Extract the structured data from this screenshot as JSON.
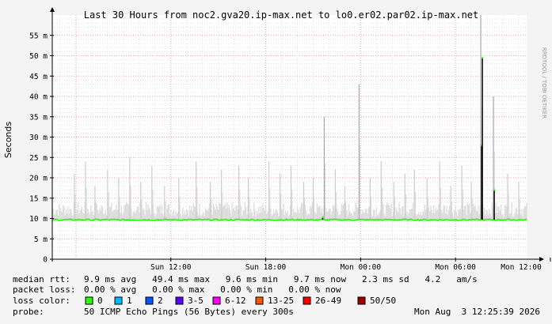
{
  "chart_data": {
    "type": "area",
    "title": "Last 30 Hours from noc2.gva20.ip-max.net to lo0.er02.par02.ip-max.net",
    "ylabel": "Seconds",
    "watermark": "RRDTOOL / TOBI OETIKER",
    "y_unit_suffix": " m",
    "ylim": [
      0,
      60
    ],
    "yticks": [
      0,
      5,
      10,
      15,
      20,
      25,
      30,
      35,
      40,
      45,
      50,
      55
    ],
    "x_range_hours": [
      4.5,
      34.5
    ],
    "x_ticks": [
      {
        "hour": 12,
        "label": "Sun 12:00"
      },
      {
        "hour": 18,
        "label": "Sun 18:00"
      },
      {
        "hour": 24,
        "label": "Mon 00:00"
      },
      {
        "hour": 30,
        "label": "Mon 06:00"
      },
      {
        "hour": 36,
        "label": "Mon 12:00"
      }
    ],
    "median_rtt_ms": 9.7,
    "spikes": [
      {
        "hour": 5.9,
        "value": 21
      },
      {
        "hour": 6.6,
        "value": 24
      },
      {
        "hour": 7.2,
        "value": 18
      },
      {
        "hour": 8.0,
        "value": 22
      },
      {
        "hour": 8.7,
        "value": 20
      },
      {
        "hour": 9.4,
        "value": 25
      },
      {
        "hour": 10.1,
        "value": 19
      },
      {
        "hour": 10.8,
        "value": 23
      },
      {
        "hour": 11.6,
        "value": 18
      },
      {
        "hour": 12.5,
        "value": 20
      },
      {
        "hour": 13.6,
        "value": 24
      },
      {
        "hour": 14.5,
        "value": 19
      },
      {
        "hour": 15.2,
        "value": 22
      },
      {
        "hour": 16.3,
        "value": 23
      },
      {
        "hour": 16.9,
        "value": 20
      },
      {
        "hour": 18.2,
        "value": 24
      },
      {
        "hour": 18.9,
        "value": 21
      },
      {
        "hour": 19.6,
        "value": 23
      },
      {
        "hour": 20.4,
        "value": 19
      },
      {
        "hour": 21.0,
        "value": 20
      },
      {
        "hour": 21.7,
        "value": 35
      },
      {
        "hour": 22.4,
        "value": 22
      },
      {
        "hour": 23.0,
        "value": 18
      },
      {
        "hour": 23.9,
        "value": 43
      },
      {
        "hour": 24.6,
        "value": 20
      },
      {
        "hour": 25.3,
        "value": 24
      },
      {
        "hour": 26.1,
        "value": 19
      },
      {
        "hour": 26.8,
        "value": 21
      },
      {
        "hour": 27.4,
        "value": 22
      },
      {
        "hour": 28.2,
        "value": 20
      },
      {
        "hour": 29.0,
        "value": 24
      },
      {
        "hour": 29.7,
        "value": 18
      },
      {
        "hour": 30.4,
        "value": 23
      },
      {
        "hour": 31.0,
        "value": 19
      },
      {
        "hour": 31.6,
        "value": 60
      },
      {
        "hour": 32.4,
        "value": 40
      },
      {
        "hour": 33.3,
        "value": 21
      },
      {
        "hour": 34.0,
        "value": 19
      }
    ],
    "median_spikes": [
      {
        "hour": 21.6,
        "value": 10.3
      },
      {
        "hour": 31.65,
        "value": 28
      },
      {
        "hour": 31.7,
        "value": 49.5
      },
      {
        "hour": 32.45,
        "value": 17
      }
    ]
  },
  "footer": {
    "rows": [
      {
        "label": "median rtt:",
        "text": "9.9 ms avg   49.4 ms max   9.6 ms min   9.7 ms now   2.3 ms sd   4.2   am/s"
      },
      {
        "label": "packet loss:",
        "text": "0.00 % avg   0.00 % max   0.00 % min   0.00 % now"
      },
      {
        "label": "loss color:",
        "text": ""
      },
      {
        "label": "probe:",
        "text": "50 ICMP Echo Pings (56 Bytes) every 300s"
      }
    ],
    "loss_colors": [
      {
        "label": "0",
        "color": "#26ff00"
      },
      {
        "label": "1",
        "color": "#00b8ff"
      },
      {
        "label": "2",
        "color": "#0059ff"
      },
      {
        "label": "3-5",
        "color": "#5e00ff"
      },
      {
        "label": "6-12",
        "color": "#ff00ff"
      },
      {
        "label": "13-25",
        "color": "#ff5500"
      },
      {
        "label": "26-49",
        "color": "#ff0000"
      },
      {
        "label": "50/50",
        "color": "#a10000"
      }
    ],
    "timestamp": "Mon Aug  3 12:25:39 2026"
  }
}
